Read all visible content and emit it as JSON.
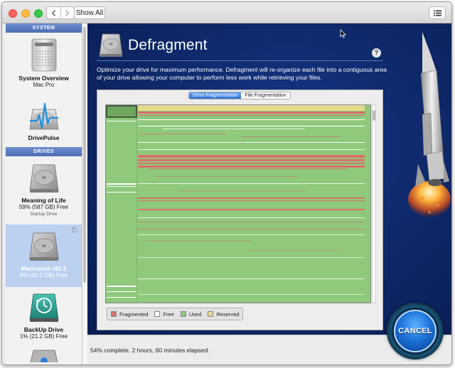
{
  "window": {
    "nav_back_icon": "chevron-left-icon",
    "nav_forward_icon": "chevron-right-icon",
    "show_all_label": "Show All",
    "list_view_icon": "list-icon"
  },
  "sidebar": {
    "system_header": "SYSTEM",
    "drives_header": "DRIVES",
    "system_items": [
      {
        "title": "System Overview",
        "subtitle": "Mac Pro",
        "icon": "mac-pro-icon"
      },
      {
        "title": "DrivePulse",
        "subtitle": "",
        "icon": "drivepulse-icon"
      }
    ],
    "drive_items": [
      {
        "title": "Meaning of Life",
        "subtitle": "59% (587 GB) Free",
        "note": "Startup Drive",
        "icon": "hard-drive-icon"
      },
      {
        "title": "Macintosh HD 2",
        "subtitle": "4% (43.2 GB) Free",
        "note": "",
        "icon": "hard-drive-icon",
        "selected": true
      },
      {
        "title": "BackUp Drive",
        "subtitle": "1% (21.2 GB) Free",
        "note": "",
        "icon": "time-machine-drive-icon"
      }
    ]
  },
  "main": {
    "title": "Defragment",
    "description": "Optimize your drive for maximum performance. Defragment will re-organize each file into a contiguous area of your drive allowing your computer to perform less work while retrieving your files.",
    "help_label": "?",
    "tabs": [
      {
        "label": "Drive Fragmentation",
        "active": true
      },
      {
        "label": "File Fragmentation",
        "active": false
      }
    ],
    "legend": [
      {
        "label": "Fragmented",
        "color": "#d9706b"
      },
      {
        "label": "Free",
        "color": "#ffffff"
      },
      {
        "label": "Used",
        "color": "#8ec97c"
      },
      {
        "label": "Reserved",
        "color": "#e3d98a"
      }
    ]
  },
  "status": {
    "text": "54% complete. 2 hours, 60 minutes elapsed."
  },
  "cancel_button": {
    "label": "CANCEL"
  },
  "colors": {
    "accent_blue": "#2f6fd8",
    "background_navy": "#0f2a6e",
    "fragmented": "#d9706b",
    "used": "#8ec97c",
    "reserved": "#e3d98a",
    "free": "#ffffff"
  }
}
